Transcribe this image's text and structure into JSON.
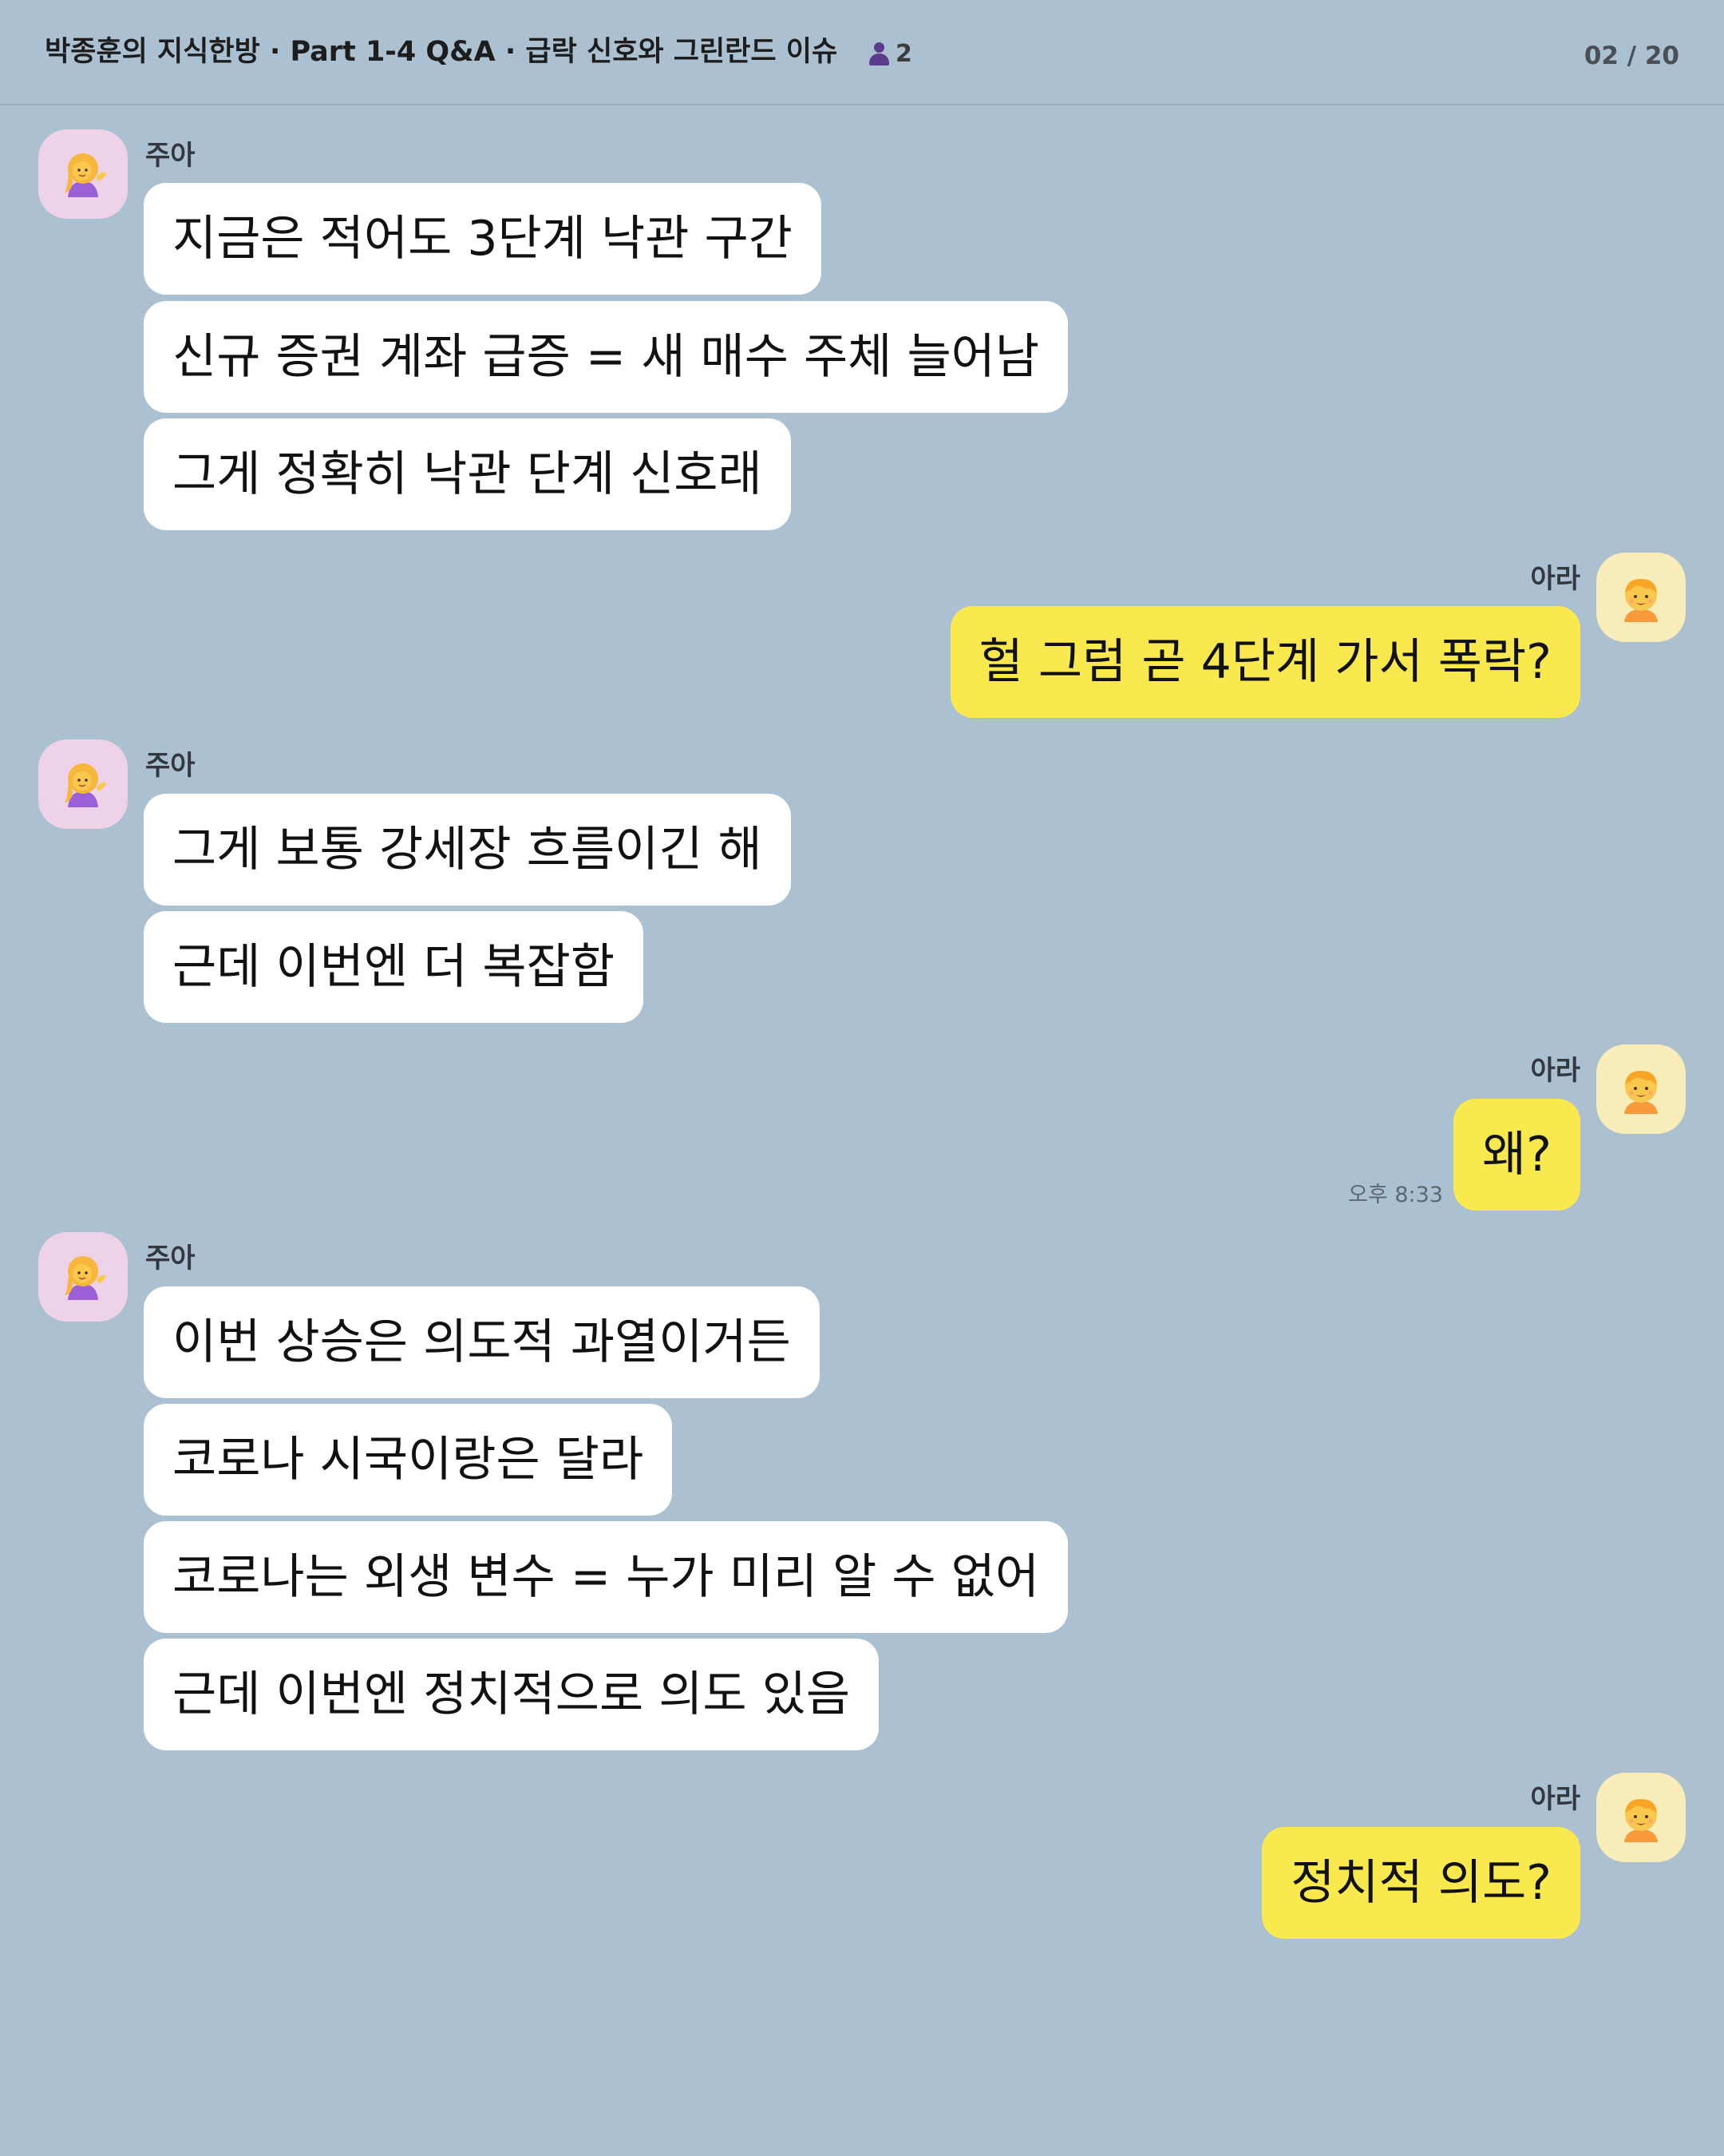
{
  "header": {
    "title": "박종훈의 지식한방 · Part 1-4 Q&A · 급락 신호와 그린란드 이슈",
    "member_count": "2",
    "page_indicator": "02 / 20"
  },
  "participants": {
    "left_name": "주아",
    "right_name": "아라"
  },
  "groups": [
    {
      "sender": "주아",
      "messages": [
        "지금은 적어도 3단계 낙관 구간",
        "신규 증권 계좌 급증 = 새 매수 주체 늘어남",
        "그게 정확히 낙관 단계 신호래"
      ]
    },
    {
      "sender": "아라",
      "messages": [
        "헐 그럼 곧 4단계 가서 폭락?"
      ]
    },
    {
      "sender": "주아",
      "messages": [
        "그게 보통 강세장 흐름이긴 해",
        "근데 이번엔 더 복잡함"
      ]
    },
    {
      "sender": "아라",
      "messages": [
        "왜?"
      ],
      "time": "오후 8:33"
    },
    {
      "sender": "주아",
      "messages": [
        "이번 상승은 의도적 과열이거든",
        "코로나 시국이랑은 달라",
        "코로나는 외생 변수 = 누가 미리 알 수 없어",
        "근데 이번엔 정치적으로 의도 있음"
      ]
    },
    {
      "sender": "아라",
      "messages": [
        "정치적 의도?"
      ]
    }
  ],
  "colors": {
    "background": "#abc1d1",
    "incoming_bubble": "#ffffff",
    "outgoing_bubble": "#fae84f",
    "left_avatar_bg": "#eed2e8",
    "right_avatar_bg": "#f8ecb8"
  },
  "icons": {
    "members": "person-icon",
    "left_avatar": "woman-tipping-hand-emoji",
    "right_avatar": "child-emoji"
  }
}
